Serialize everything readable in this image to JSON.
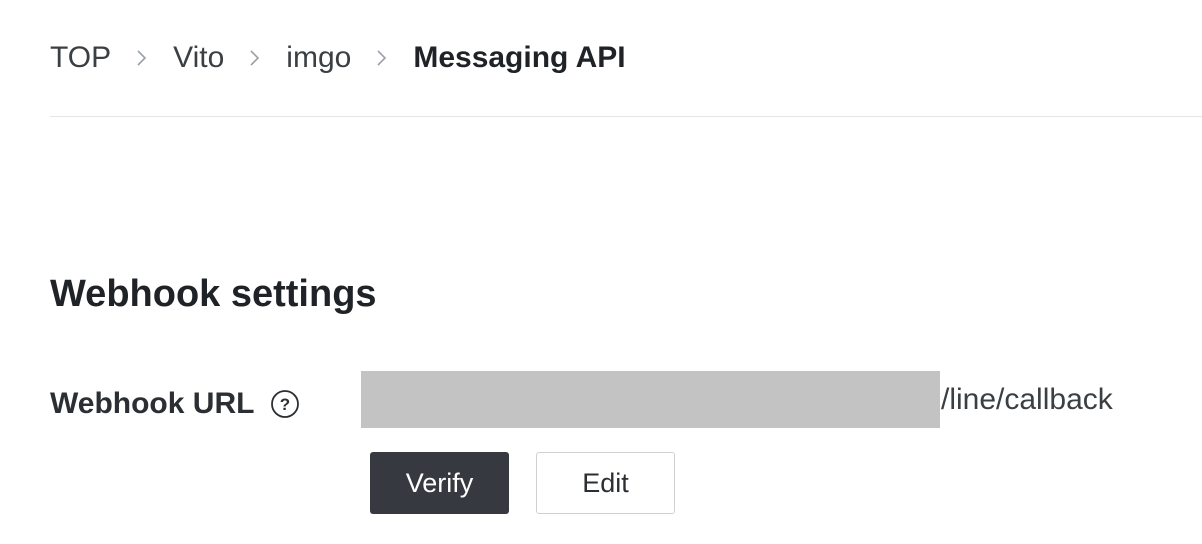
{
  "breadcrumb": {
    "items": [
      {
        "label": "TOP"
      },
      {
        "label": "Vito"
      },
      {
        "label": "imgo"
      },
      {
        "label": "Messaging API"
      }
    ],
    "separator_icon": "chevron-right-icon"
  },
  "webhook_section": {
    "title": "Webhook settings",
    "url_field": {
      "label": "Webhook URL",
      "help_icon": "question-circle-icon",
      "value_suffix": "/line/callback",
      "value_prefix_redacted": true
    },
    "buttons": {
      "verify_label": "Verify",
      "edit_label": "Edit"
    }
  },
  "colors": {
    "primary_button": "#363a40",
    "redaction": "#c3c3c3",
    "divider": "#e4e6e8"
  }
}
